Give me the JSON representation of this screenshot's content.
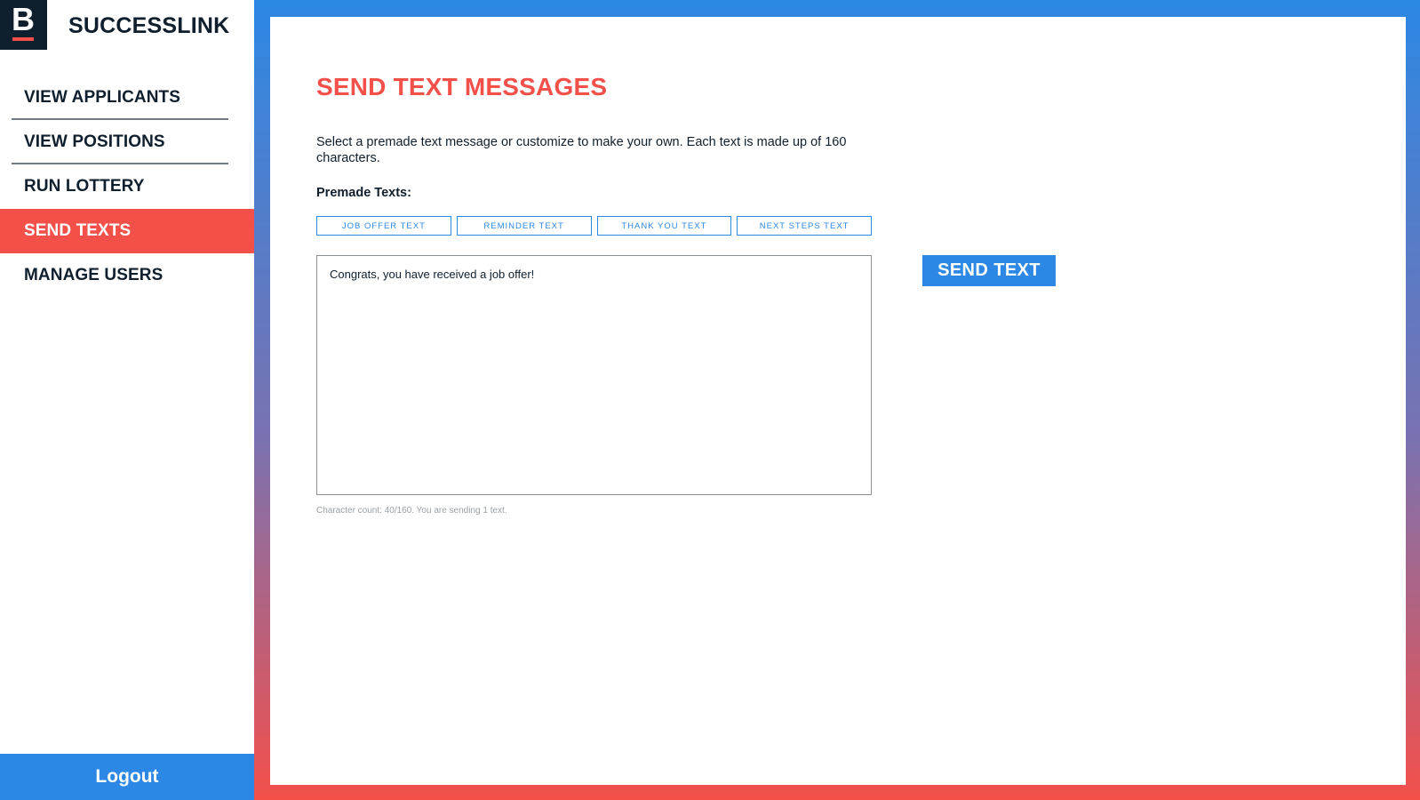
{
  "brand": {
    "logo_letter": "B",
    "name": "SUCCESSLINK"
  },
  "sidebar": {
    "items": [
      {
        "label": "VIEW APPLICANTS",
        "active": false
      },
      {
        "label": "VIEW POSITIONS",
        "active": false
      },
      {
        "label": "RUN LOTTERY",
        "active": false
      },
      {
        "label": "SEND TEXTS",
        "active": true
      },
      {
        "label": "MANAGE USERS",
        "active": false
      }
    ],
    "logout_label": "Logout"
  },
  "main": {
    "title": "SEND TEXT MESSAGES",
    "intro": "Select a premade text message or customize to make your own. Each text is made up of 160 characters.",
    "premade_label": "Premade Texts:",
    "premade_buttons": [
      "JOB OFFER TEXT",
      "REMINDER TEXT",
      "THANK YOU TEXT",
      "NEXT STEPS TEXT"
    ],
    "message_value": "Congrats, you have received a job offer!",
    "char_count": "Character count: 40/160. You are sending 1 text.",
    "send_label": "SEND TEXT"
  },
  "colors": {
    "accent_red": "#f4504a",
    "accent_blue": "#2c88e4",
    "navy": "#0f1f2d"
  }
}
